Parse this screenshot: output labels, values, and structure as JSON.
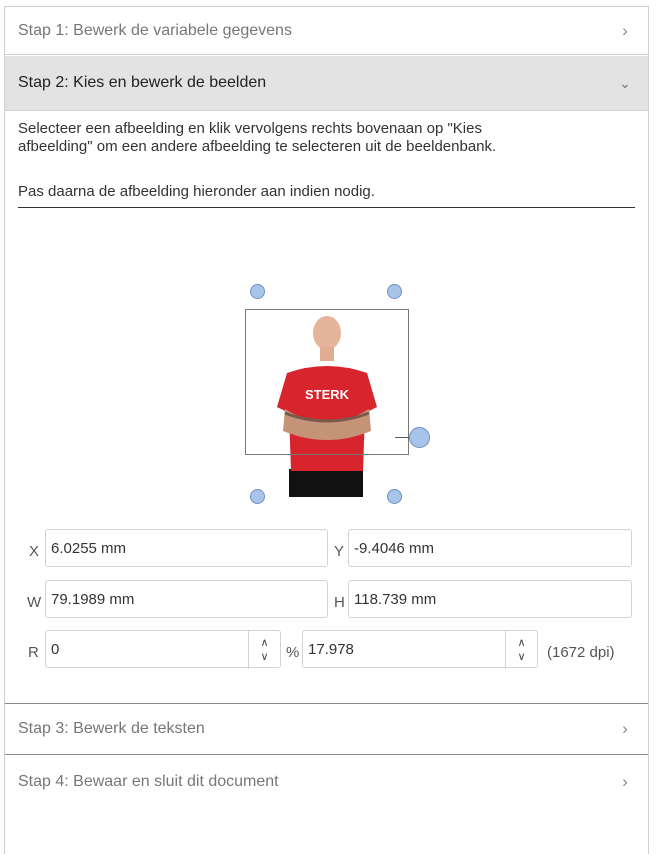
{
  "steps": [
    {
      "label": "Stap 1: Bewerk de variabele gegevens",
      "state": "collapsed"
    },
    {
      "label": "Stap 2: Kies en bewerk de beelden",
      "state": "expanded"
    },
    {
      "label": "Stap 3: Bewerk de teksten",
      "state": "collapsed"
    },
    {
      "label": "Stap 4: Bewaar en sluit dit document",
      "state": "collapsed"
    }
  ],
  "step2": {
    "instruction_line1": "Selecteer een afbeelding en klik vervolgens rechts bovenaan op \"Kies",
    "instruction_line2": "afbeelding\" om een andere afbeelding te selecteren uit de beeldenbank.",
    "instruction2": "Pas daarna de afbeelding hieronder aan indien nodig.",
    "image_shirt_text": "STERK"
  },
  "fields": {
    "x": {
      "label": "X",
      "value": "6.0255 mm"
    },
    "y": {
      "label": "Y",
      "value": "-9.4046 mm"
    },
    "w": {
      "label": "W",
      "value": "79.1989 mm"
    },
    "h": {
      "label": "H",
      "value": "118.739 mm"
    },
    "r": {
      "label": "R",
      "value": "0"
    },
    "scale": {
      "label": "%",
      "value": "17.978"
    },
    "dpi": "(1672 dpi)"
  },
  "icons": {
    "chevron_right": "›",
    "chevron_down": "⌄",
    "spin_up": "∧",
    "spin_down": "∨"
  },
  "colors": {
    "active_step_bg": "#e3e3e3",
    "handle": "#a8c4ea",
    "shirt": "#d8242d"
  }
}
